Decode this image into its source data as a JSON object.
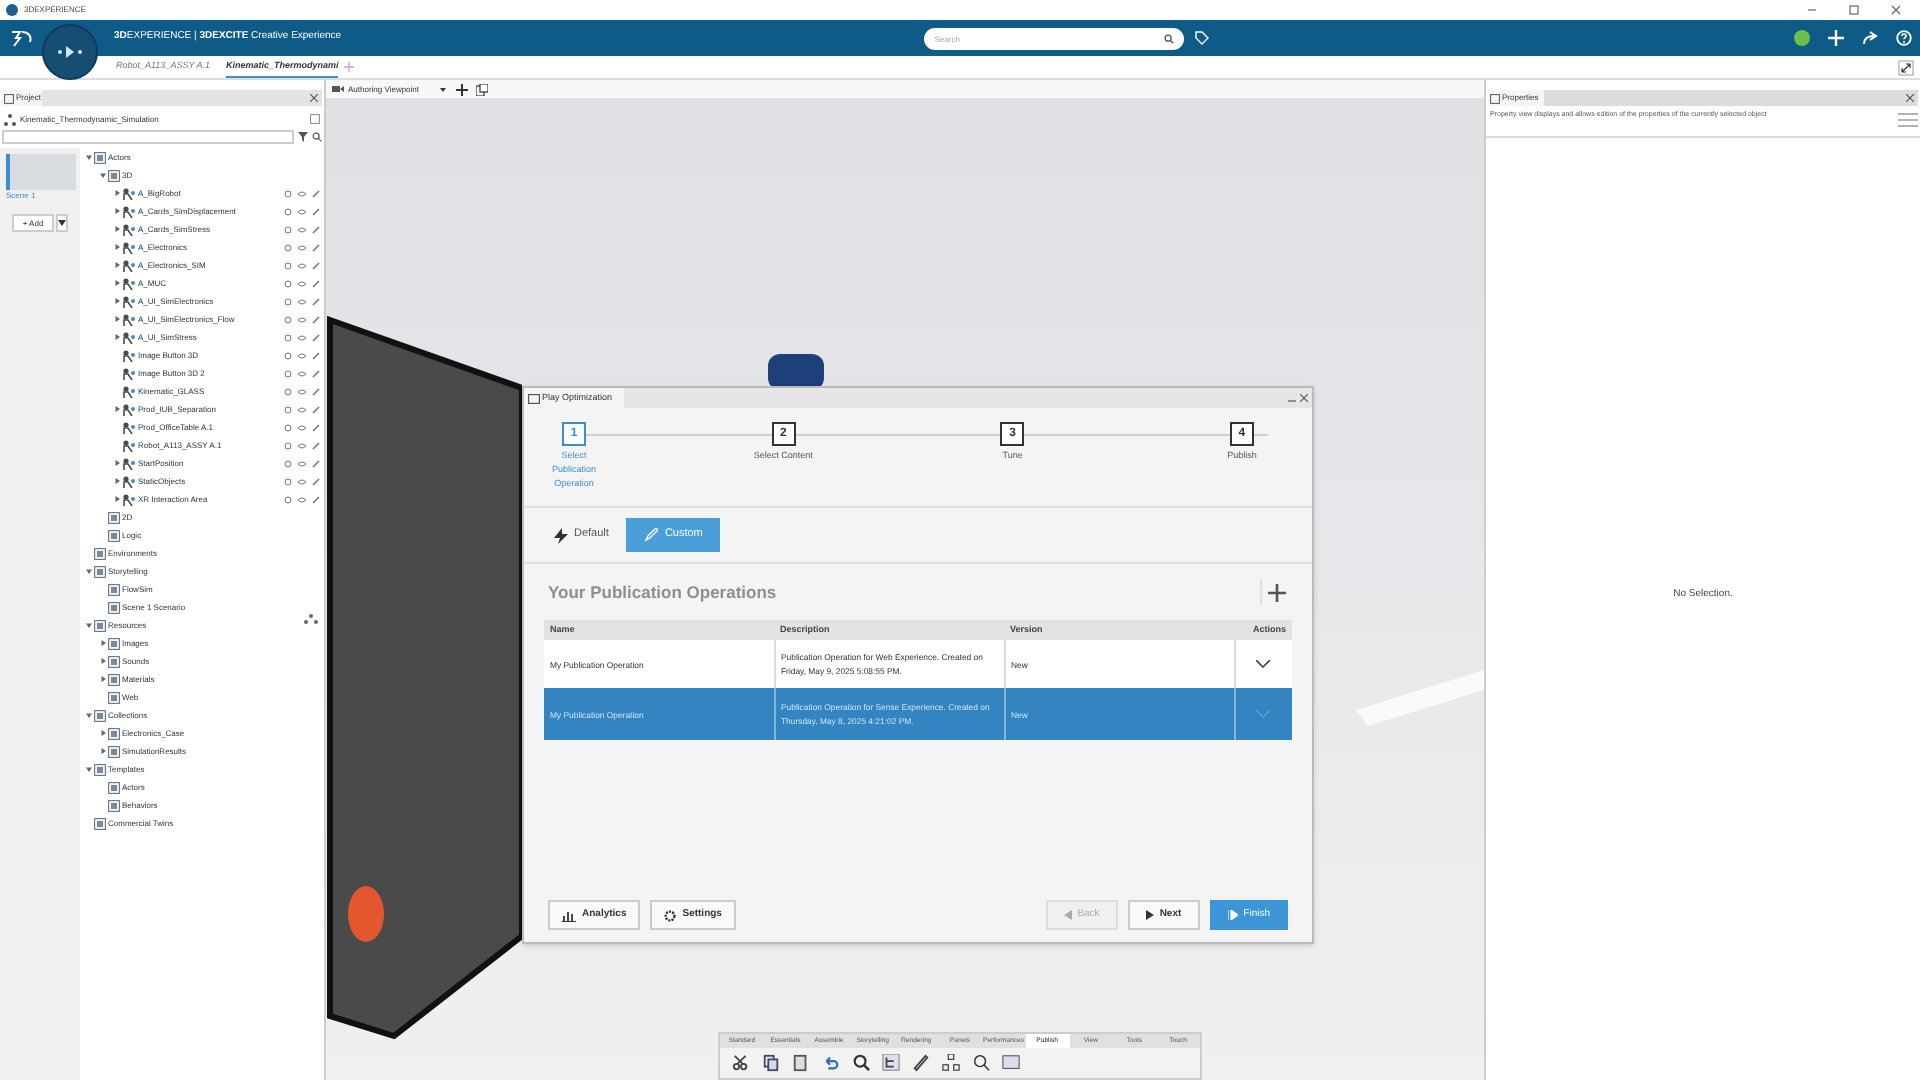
{
  "app_title": "3DEXPERIENCE",
  "brand": "**3D**EXPERIENCE | **3DEXCITE** Creative Experience",
  "search": {
    "placeholder": "Search"
  },
  "doc_tabs": [
    {
      "label": "Robot_A113_ASSY A.1",
      "selected": false
    },
    {
      "label": "Kinematic_Thermodynami",
      "selected": true
    }
  ],
  "viewport": {
    "viewpoint": "Authoring Viewpoint"
  },
  "project": {
    "tab": "Project",
    "root": "Kinematic_Thermodynamic_Simulation",
    "scene": "Scene 1",
    "add_button": "+ Add",
    "tree": [
      {
        "label": "Actors",
        "kind": "folder",
        "expanded": true,
        "children": [
          {
            "label": "3D",
            "kind": "folder",
            "expanded": true,
            "children": [
              {
                "label": "A_BigRobot",
                "kind": "actor",
                "expanded": false
              },
              {
                "label": "A_Cards_SimDisplacement",
                "kind": "actor",
                "expanded": false
              },
              {
                "label": "A_Cards_SimStress",
                "kind": "actor",
                "expanded": false
              },
              {
                "label": "A_Electronics",
                "kind": "actor",
                "expanded": false
              },
              {
                "label": "A_Electronics_SIM",
                "kind": "actor",
                "expanded": false
              },
              {
                "label": "A_MUC",
                "kind": "actor",
                "expanded": false
              },
              {
                "label": "A_UI_SimElectronics",
                "kind": "actor",
                "expanded": false
              },
              {
                "label": "A_UI_SimElectronics_Flow",
                "kind": "actor",
                "expanded": false
              },
              {
                "label": "A_UI_SimStress",
                "kind": "actor",
                "expanded": false
              },
              {
                "label": "Image Button 3D",
                "kind": "actor"
              },
              {
                "label": "Image Button 3D 2",
                "kind": "actor"
              },
              {
                "label": "Kinematic_GLASS",
                "kind": "actor"
              },
              {
                "label": "Prod_IUB_Separation",
                "kind": "actor",
                "expanded": false
              },
              {
                "label": "Prod_OfficeTable A.1",
                "kind": "actor"
              },
              {
                "label": "Robot_A113_ASSY A.1",
                "kind": "actor"
              },
              {
                "label": "StartPosition",
                "kind": "actor",
                "expanded": false
              },
              {
                "label": "StaticObjects",
                "kind": "actor",
                "expanded": false
              },
              {
                "label": "XR Interaction Area",
                "kind": "actor",
                "expanded": false
              }
            ]
          },
          {
            "label": "2D",
            "kind": "folder"
          },
          {
            "label": "Logic",
            "kind": "folder"
          }
        ]
      },
      {
        "label": "Environments",
        "kind": "folder"
      },
      {
        "label": "Storytelling",
        "kind": "folder",
        "expanded": true,
        "children": [
          {
            "label": "FlowSim",
            "kind": "folder"
          },
          {
            "label": "Scene 1 Scenario",
            "kind": "folder"
          }
        ]
      },
      {
        "label": "Resources",
        "kind": "folder",
        "expanded": true,
        "children": [
          {
            "label": "Images",
            "kind": "folder",
            "expanded": false
          },
          {
            "label": "Sounds",
            "kind": "folder",
            "expanded": false
          },
          {
            "label": "Materials",
            "kind": "folder",
            "expanded": false
          },
          {
            "label": "Web",
            "kind": "folder"
          }
        ]
      },
      {
        "label": "Collections",
        "kind": "folder",
        "expanded": true,
        "children": [
          {
            "label": "Electronics_Case",
            "kind": "folder",
            "expanded": false
          },
          {
            "label": "SimulationResults",
            "kind": "folder",
            "expanded": false
          }
        ]
      },
      {
        "label": "Templates",
        "kind": "folder",
        "expanded": true,
        "children": [
          {
            "label": "Actors",
            "kind": "folder"
          },
          {
            "label": "Behaviors",
            "kind": "folder"
          }
        ]
      },
      {
        "label": "Commercial Twins",
        "kind": "folder"
      }
    ]
  },
  "dialog": {
    "title": "Play Optimization",
    "steps": [
      {
        "number": "1",
        "label": "Select Publication Operation",
        "selected": true
      },
      {
        "number": "2",
        "label": "Select Content",
        "selected": false
      },
      {
        "number": "3",
        "label": "Tune",
        "selected": false
      },
      {
        "number": "4",
        "label": "Publish",
        "selected": false
      }
    ],
    "modes": [
      {
        "label": "Default",
        "selected": false
      },
      {
        "label": "Custom",
        "selected": true
      }
    ],
    "heading": "Your Publication Operations",
    "table": {
      "columns": [
        "Name",
        "Description",
        "Version",
        "Actions"
      ],
      "rows": [
        {
          "name": "My Publication Operation",
          "description": "Publication Operation for Web Experience. Created on Friday, May 9, 2025 5:08:55 PM.",
          "version": "New",
          "selected": false
        },
        {
          "name": "My Publication Operation",
          "description": "Publication Operation for Sense Experience. Created on Thursday, May 8, 2025 4:21:02 PM.",
          "version": "New",
          "selected": true
        }
      ]
    },
    "footer_left": [
      "Analytics",
      "Settings"
    ],
    "footer_right": [
      {
        "label": "Back",
        "kind": "nav",
        "disabled": true
      },
      {
        "label": "Next",
        "kind": "nav",
        "disabled": false
      },
      {
        "label": "Finish",
        "kind": "primary",
        "disabled": false
      }
    ]
  },
  "properties": {
    "tab": "Properties",
    "description": "Property view displays and allows edition of the properties of the currently selected object",
    "empty": "No Selection."
  },
  "toolbar_tabs": [
    {
      "label": "Standard",
      "selected": false
    },
    {
      "label": "Essentials",
      "selected": false
    },
    {
      "label": "Assemble",
      "selected": false
    },
    {
      "label": "Storytelling",
      "selected": false
    },
    {
      "label": "Rendering",
      "selected": false
    },
    {
      "label": "Panels",
      "selected": false
    },
    {
      "label": "Performances",
      "selected": false
    },
    {
      "label": "Publish",
      "selected": true
    },
    {
      "label": "View",
      "selected": false
    },
    {
      "label": "Tools",
      "selected": false
    },
    {
      "label": "Touch",
      "selected": false
    }
  ]
}
